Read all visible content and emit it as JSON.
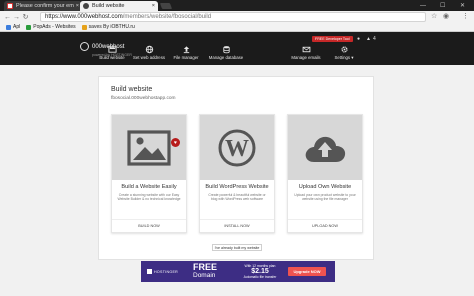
{
  "browser": {
    "tabs": [
      {
        "title": "Please confirm your em",
        "active": false
      },
      {
        "title": "Build website",
        "active": true
      }
    ],
    "url_domain": "https://www.000webhost.com",
    "url_path": "/members/website/fbosocial/build",
    "bookmarks": [
      "Apl",
      "PopAds - Websites",
      "saves By iOBTHU.ru"
    ]
  },
  "header": {
    "logo_text": "000webhost",
    "logo_sub": "powered by HOSTINGER",
    "dev_button": "FREE Developer Tool",
    "notification_count": "4",
    "nav": [
      {
        "label": "Build website",
        "icon": "build-icon"
      },
      {
        "label": "Set web address",
        "icon": "globe-icon"
      },
      {
        "label": "File manager",
        "icon": "upload-icon"
      },
      {
        "label": "Manage database",
        "icon": "database-icon"
      },
      {
        "label": "Manage emails",
        "icon": "mail-icon"
      },
      {
        "label": "Settings",
        "icon": "gear-icon"
      }
    ]
  },
  "panel": {
    "title": "Build website",
    "subtitle": "fbosocial.000webhostapp.com",
    "cards": [
      {
        "title": "Build a Website Easily",
        "desc": "Create a stunning website with our Easy Website Builder & no technical knowledge",
        "button": "BUILD NOW",
        "icon": "image-icon"
      },
      {
        "title": "Build WordPress Website",
        "desc": "Create powerful & beautiful website or blog with WordPress web software",
        "button": "INSTALL NOW",
        "icon": "wordpress-icon"
      },
      {
        "title": "Upload Own Website",
        "desc": "Upload your own product website to your website using the file manager",
        "button": "UPLOAD NOW",
        "icon": "cloud-upload-icon"
      }
    ],
    "already_label": "I've already built my website"
  },
  "banner": {
    "brand": "HOSTINGER",
    "free": "FREE",
    "domain": "Domain",
    "offer_line1": "With 12 months plan",
    "price": "$2.15",
    "offer_line2": "Automatic file transfer",
    "cta": "Upgrade NOW"
  },
  "colors": {
    "header_bg": "#1b1b1b",
    "accent_red": "#c62828",
    "banner_bg": "#3d2d84"
  }
}
